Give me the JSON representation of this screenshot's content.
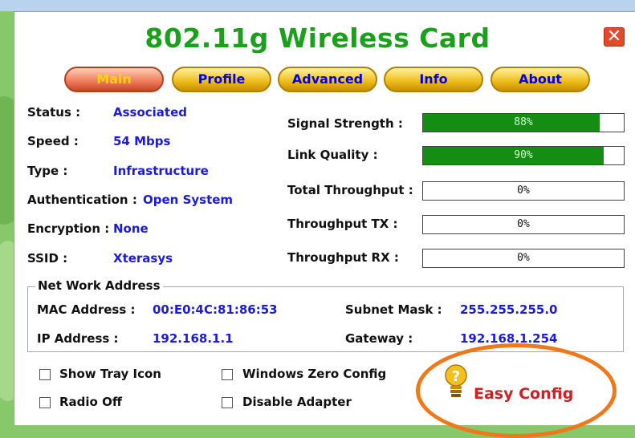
{
  "window": {
    "title": "802.11g Wireless Card",
    "close_glyph": "✕"
  },
  "tabs": [
    {
      "label": "Main",
      "active": true
    },
    {
      "label": "Profile",
      "active": false
    },
    {
      "label": "Advanced",
      "active": false
    },
    {
      "label": "Info",
      "active": false
    },
    {
      "label": "About",
      "active": false
    }
  ],
  "status": {
    "status_label": "Status :",
    "status_value": "Associated",
    "speed_label": "Speed :",
    "speed_value": "54 Mbps",
    "type_label": "Type :",
    "type_value": "Infrastructure",
    "auth_label": "Authentication :",
    "auth_value": "Open System",
    "enc_label": "Encryption :",
    "enc_value": "None",
    "ssid_label": "SSID :",
    "ssid_value": "Xterasys"
  },
  "meters": [
    {
      "label": "Signal Strength :",
      "text": "88%",
      "fraction": 0.88
    },
    {
      "label": "Link Quality :",
      "text": "90%",
      "fraction": 0.9
    },
    {
      "label": "Total Throughput :",
      "text": "0%",
      "fraction": 0
    },
    {
      "label": "Throughput TX :",
      "text": "0%",
      "fraction": 0
    },
    {
      "label": "Throughput RX :",
      "text": "0%",
      "fraction": 0
    }
  ],
  "network": {
    "legend": "Net Work Address",
    "mac_label": "MAC Address :",
    "mac_value": "00:E0:4C:81:86:53",
    "ip_label": "IP Address :",
    "ip_value": "192.168.1.1",
    "subnet_label": "Subnet Mask :",
    "subnet_value": "255.255.255.0",
    "gateway_label": "Gateway :",
    "gateway_value": "192.168.1.254"
  },
  "options": {
    "show_tray_icon": "Show Tray Icon",
    "radio_off": "Radio Off",
    "windows_zero_config": "Windows Zero Config",
    "disable_adapter": "Disable Adapter"
  },
  "easy_config": {
    "label": "Easy Config",
    "icon": "lightbulb-question-icon"
  },
  "colors": {
    "title_green": "#1aa01a",
    "value_blue": "#1a1ae0",
    "meter_green": "#138e13",
    "highlight_orange": "#f07818",
    "easy_config_red": "#d02020"
  }
}
